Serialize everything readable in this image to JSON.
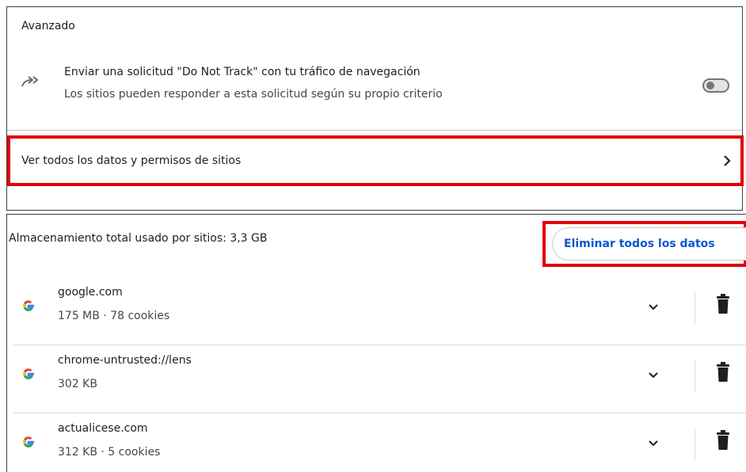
{
  "advanced": {
    "title": "Avanzado",
    "do_not_track": {
      "title": "Enviar una solicitud \"Do Not Track\" con tu tráfico de navegación",
      "subtitle": "Los sitios pueden responder a esta solicitud según su propio criterio",
      "icon": "do-not-track-arrow-icon",
      "enabled": false
    },
    "site_data_link": {
      "label": "Ver todos los datos y permisos de sitios",
      "icon": "chevron-right-icon"
    }
  },
  "storage": {
    "label": "Almacenamiento total usado por sitios: 3,3 GB",
    "clear_all_label": "Eliminar todos los datos"
  },
  "sites": [
    {
      "name": "google.com",
      "meta": "175 MB · 78 cookies",
      "icon": "google-g-icon"
    },
    {
      "name": "chrome-untrusted://lens",
      "meta": "302 KB",
      "icon": "google-g-icon"
    },
    {
      "name": "actualicese.com",
      "meta": "312 KB · 5 cookies",
      "icon": "google-g-icon"
    }
  ],
  "colors": {
    "highlight": "#e0000b",
    "link_blue": "#0b57d0"
  }
}
